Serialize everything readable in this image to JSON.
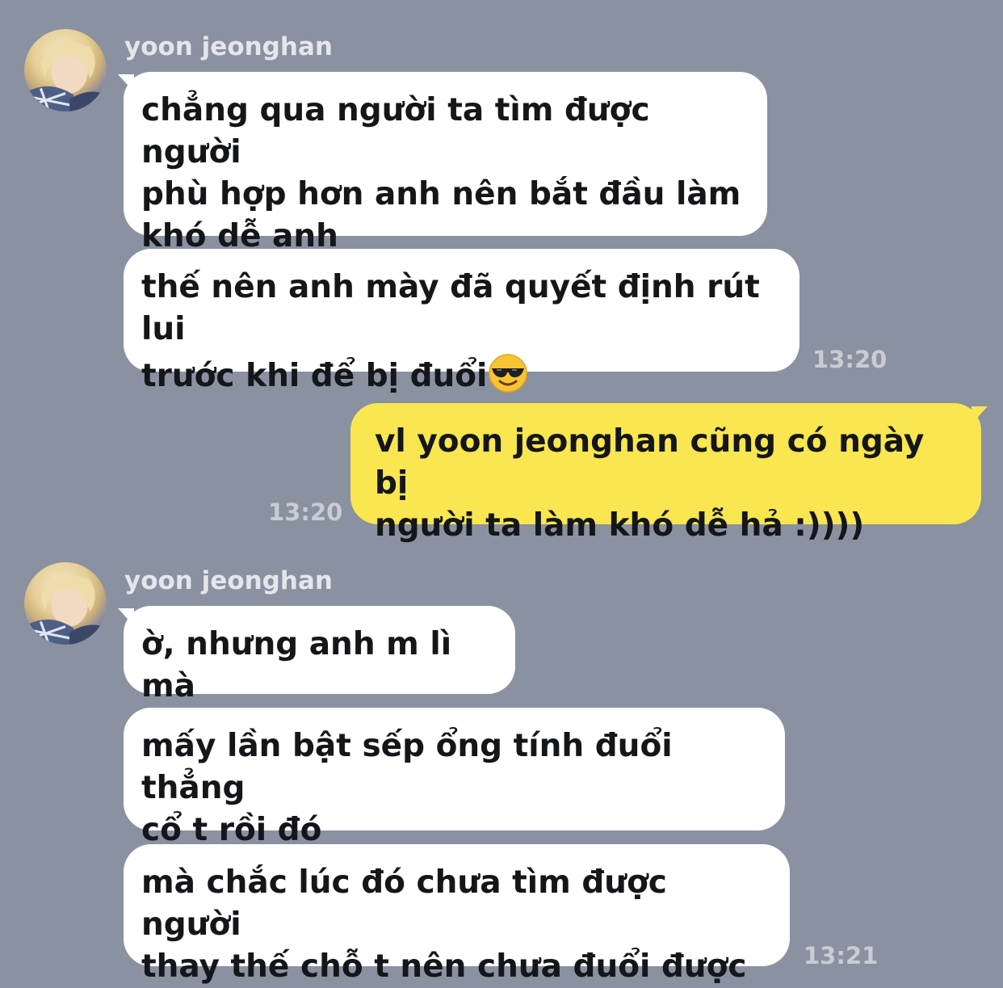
{
  "chat": {
    "groups": [
      {
        "sender": "yoon jeonghan",
        "messages": [
          "chẳng qua người ta tìm được người\nphù hợp hơn anh nên bắt đầu làm\nkhó dễ anh",
          "thế nên anh mày đã quyết định rút lui\ntrước khi để bị đuổi"
        ],
        "emoji_icon": "smiling-face-with-sunglasses-icon",
        "time": "13:20"
      },
      {
        "sender": "me",
        "messages": [
          "vl yoon jeonghan cũng có ngày bị\nngười ta làm khó dễ hả :))))"
        ],
        "time": "13:20"
      },
      {
        "sender": "yoon jeonghan",
        "messages": [
          "ờ, nhưng anh m lì mà",
          "mấy lần bật sếp ổng tính đuổi thẳng\ncổ t rồi đó",
          "mà chắc lúc đó chưa tìm được người\nthay thế chỗ t nên chưa đuổi được"
        ],
        "time": "13:21"
      }
    ]
  },
  "colors": {
    "background": "#8a91a1",
    "incoming_bubble": "#ffffff",
    "outgoing_bubble": "#f9e650",
    "sender_name": "#e4e6eb",
    "timestamp": "#c9ccd4"
  }
}
